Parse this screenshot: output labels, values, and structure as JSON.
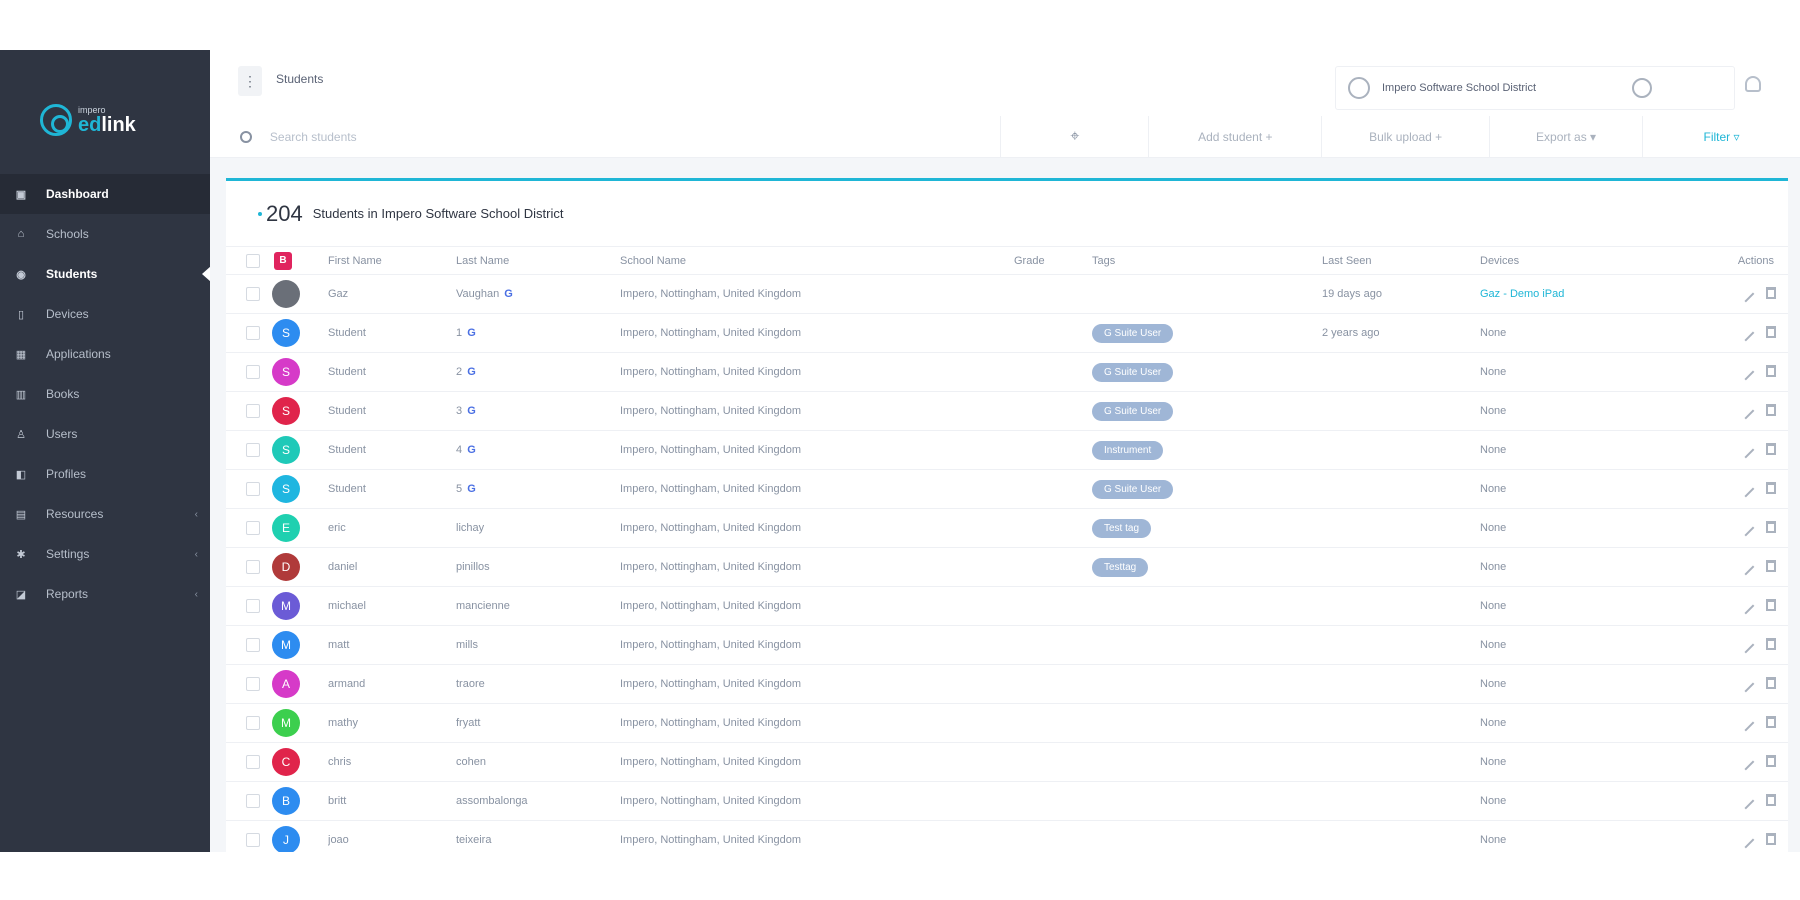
{
  "brand": {
    "small": "impero",
    "ed": "ed",
    "link": "link"
  },
  "sidebar": {
    "items": [
      {
        "label": "Dashboard",
        "icon": "dashboard-icon",
        "glyph": "▣",
        "state": "active"
      },
      {
        "label": "Schools",
        "icon": "school-icon",
        "glyph": "⌂",
        "state": ""
      },
      {
        "label": "Students",
        "icon": "students-icon",
        "glyph": "◉",
        "state": "current"
      },
      {
        "label": "Devices",
        "icon": "device-icon",
        "glyph": "▯",
        "state": ""
      },
      {
        "label": "Applications",
        "icon": "applications-icon",
        "glyph": "▦",
        "state": ""
      },
      {
        "label": "Books",
        "icon": "books-icon",
        "glyph": "▥",
        "state": ""
      },
      {
        "label": "Users",
        "icon": "users-icon",
        "glyph": "♙",
        "state": ""
      },
      {
        "label": "Profiles",
        "icon": "profiles-icon",
        "glyph": "◧",
        "state": ""
      },
      {
        "label": "Resources",
        "icon": "resources-icon",
        "glyph": "▤",
        "state": "",
        "chevron": "‹"
      },
      {
        "label": "Settings",
        "icon": "settings-icon",
        "glyph": "✱",
        "state": "",
        "chevron": "‹"
      },
      {
        "label": "Reports",
        "icon": "reports-icon",
        "glyph": "◪",
        "state": "",
        "chevron": "‹"
      }
    ]
  },
  "header": {
    "menu_glyph": "⋮",
    "breadcrumb": "Students",
    "district": "Impero Software School District"
  },
  "toolbar": {
    "search_placeholder": "Search students",
    "target_glyph": "⌖",
    "add_label": "Add student +",
    "bulk_label": "Bulk upload +",
    "export_label": "Export as ▾",
    "filter_label": "Filter ▿"
  },
  "summary": {
    "count": "204",
    "label": "Students in Impero Software School District",
    "select_badge": "B"
  },
  "columns": {
    "first": "First Name",
    "last": "Last Name",
    "school": "School Name",
    "grade": "Grade",
    "tags": "Tags",
    "seen": "Last Seen",
    "devices": "Devices",
    "actions": "Actions"
  },
  "rows": [
    {
      "initial": "",
      "color": "#6a6f78",
      "first": "Gaz",
      "last": "Vaughan",
      "google": true,
      "school": "Impero, Nottingham, United Kingdom",
      "grade": "",
      "tag": "",
      "seen": "19 days ago",
      "device": "Gaz - Demo iPad",
      "device_link": true
    },
    {
      "initial": "S",
      "color": "#2d8cf0",
      "first": "Student",
      "last": "1",
      "google": true,
      "school": "Impero, Nottingham, United Kingdom",
      "grade": "",
      "tag": "G Suite User",
      "seen": "2 years ago",
      "device": "None",
      "device_link": false
    },
    {
      "initial": "S",
      "color": "#d63ac8",
      "first": "Student",
      "last": "2",
      "google": true,
      "school": "Impero, Nottingham, United Kingdom",
      "grade": "",
      "tag": "G Suite User",
      "seen": "",
      "device": "None",
      "device_link": false
    },
    {
      "initial": "S",
      "color": "#e0244b",
      "first": "Student",
      "last": "3",
      "google": true,
      "school": "Impero, Nottingham, United Kingdom",
      "grade": "",
      "tag": "G Suite User",
      "seen": "",
      "device": "None",
      "device_link": false
    },
    {
      "initial": "S",
      "color": "#1fc9b8",
      "first": "Student",
      "last": "4",
      "google": true,
      "school": "Impero, Nottingham, United Kingdom",
      "grade": "",
      "tag": "Instrument",
      "seen": "",
      "device": "None",
      "device_link": false
    },
    {
      "initial": "S",
      "color": "#1fb6e0",
      "first": "Student",
      "last": "5",
      "google": true,
      "school": "Impero, Nottingham, United Kingdom",
      "grade": "",
      "tag": "G Suite User",
      "seen": "",
      "device": "None",
      "device_link": false
    },
    {
      "initial": "E",
      "color": "#1fd0b0",
      "first": "eric",
      "last": "lichay",
      "google": false,
      "school": "Impero, Nottingham, United Kingdom",
      "grade": "",
      "tag": "Test tag",
      "seen": "",
      "device": "None",
      "device_link": false
    },
    {
      "initial": "D",
      "color": "#b03a3a",
      "first": "daniel",
      "last": "pinillos",
      "google": false,
      "school": "Impero, Nottingham, United Kingdom",
      "grade": "",
      "tag": "Testtag",
      "seen": "",
      "device": "None",
      "device_link": false
    },
    {
      "initial": "M",
      "color": "#6b5bd6",
      "first": "michael",
      "last": "mancienne",
      "google": false,
      "school": "Impero, Nottingham, United Kingdom",
      "grade": "",
      "tag": "",
      "seen": "",
      "device": "None",
      "device_link": false
    },
    {
      "initial": "M",
      "color": "#2d8cf0",
      "first": "matt",
      "last": "mills",
      "google": false,
      "school": "Impero, Nottingham, United Kingdom",
      "grade": "",
      "tag": "",
      "seen": "",
      "device": "None",
      "device_link": false
    },
    {
      "initial": "A",
      "color": "#d63ac8",
      "first": "armand",
      "last": "traore",
      "google": false,
      "school": "Impero, Nottingham, United Kingdom",
      "grade": "",
      "tag": "",
      "seen": "",
      "device": "None",
      "device_link": false
    },
    {
      "initial": "M",
      "color": "#3ccf4e",
      "first": "mathy",
      "last": "fryatt",
      "google": false,
      "school": "Impero, Nottingham, United Kingdom",
      "grade": "",
      "tag": "",
      "seen": "",
      "device": "None",
      "device_link": false
    },
    {
      "initial": "C",
      "color": "#e0244b",
      "first": "chris",
      "last": "cohen",
      "google": false,
      "school": "Impero, Nottingham, United Kingdom",
      "grade": "",
      "tag": "",
      "seen": "",
      "device": "None",
      "device_link": false
    },
    {
      "initial": "B",
      "color": "#2d8cf0",
      "first": "britt",
      "last": "assombalonga",
      "google": false,
      "school": "Impero, Nottingham, United Kingdom",
      "grade": "",
      "tag": "",
      "seen": "",
      "device": "None",
      "device_link": false
    },
    {
      "initial": "J",
      "color": "#2d8cf0",
      "first": "joao",
      "last": "teixeira",
      "google": false,
      "school": "Impero, Nottingham, United Kingdom",
      "grade": "",
      "tag": "",
      "seen": "",
      "device": "None",
      "device_link": false
    }
  ]
}
